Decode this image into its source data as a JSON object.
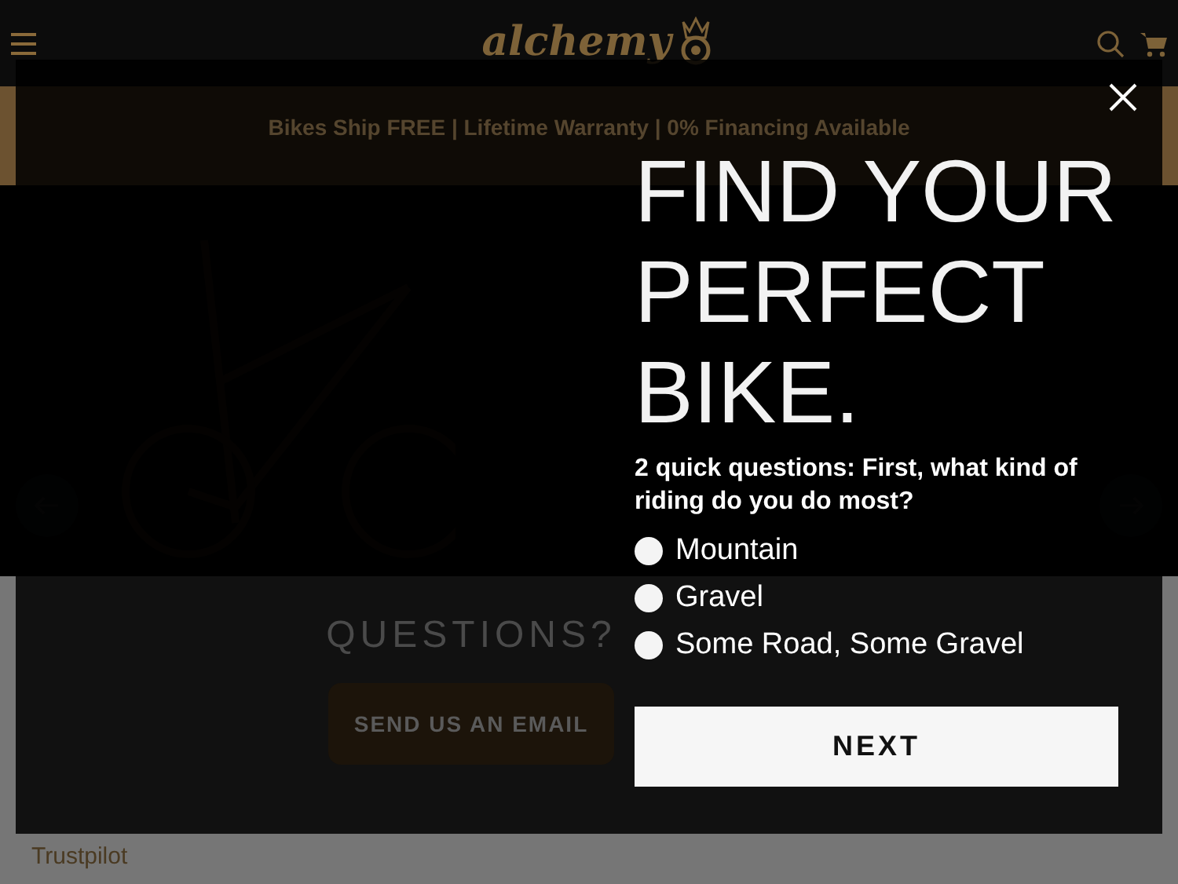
{
  "header": {
    "logo": "alchemy"
  },
  "banner": {
    "text": "Bikes Ship FREE | Lifetime Warranty | 0% Financing Available"
  },
  "contact": {
    "heading": "QUESTIONS?",
    "button": "SEND US AN EMAIL"
  },
  "footer": {
    "trustpilot": "Trustpilot"
  },
  "modal": {
    "title": "FIND YOUR PERFECT BIKE.",
    "question": "2 quick questions: First, what kind of riding do you do most?",
    "options": [
      {
        "label": "Mountain",
        "selected": false
      },
      {
        "label": "Gravel",
        "selected": false
      },
      {
        "label": "Some Road, Some Gravel",
        "selected": false
      }
    ],
    "next_button": "NEXT"
  }
}
